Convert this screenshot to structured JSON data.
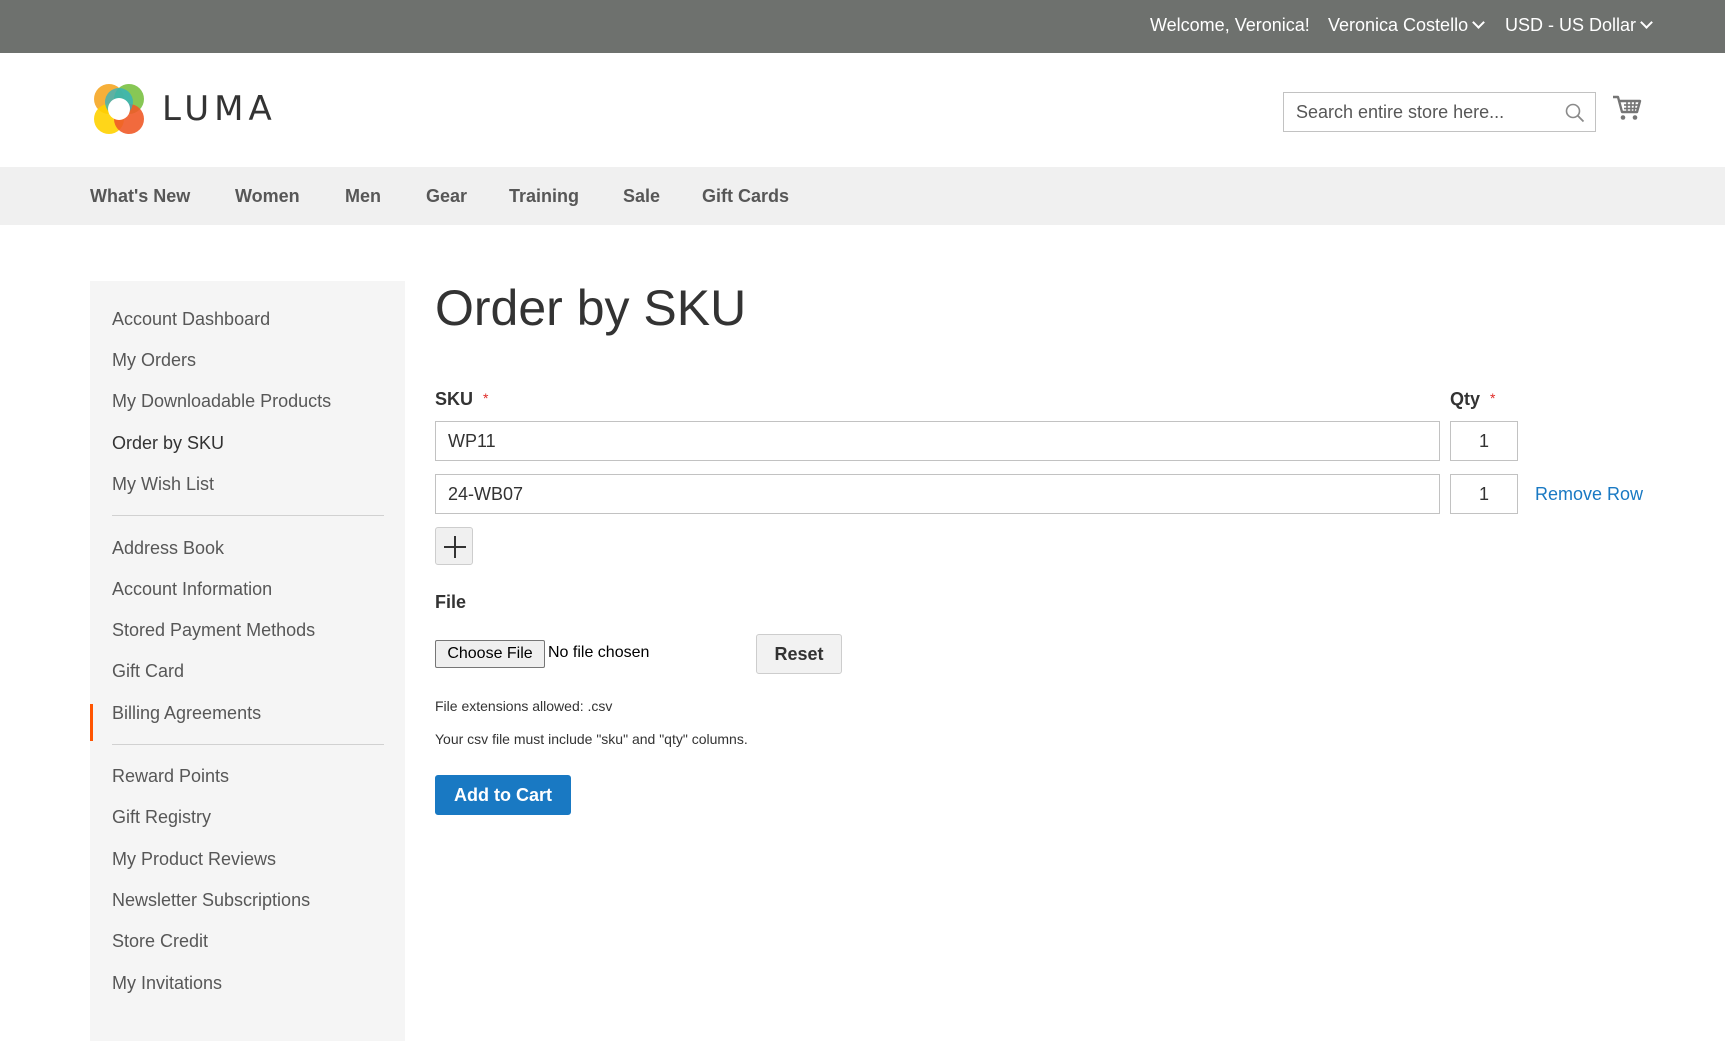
{
  "top_bar": {
    "welcome": "Welcome, Veronica!",
    "customer_name": "Veronica Costello",
    "currency": "USD - US Dollar"
  },
  "header": {
    "logo_text": "LUMA",
    "search_placeholder": "Search entire store here...",
    "cart_icon": "cart-icon"
  },
  "nav": {
    "items": [
      "What's New",
      "Women",
      "Men",
      "Gear",
      "Training",
      "Sale",
      "Gift Cards"
    ]
  },
  "sidebar": {
    "groups": [
      [
        "Account Dashboard",
        "My Orders",
        "My Downloadable Products",
        "Order by SKU",
        "My Wish List"
      ],
      [
        "Address Book",
        "Account Information",
        "Stored Payment Methods",
        "Gift Card",
        "Billing Agreements"
      ],
      [
        "Reward Points",
        "Gift Registry",
        "My Product Reviews",
        "Newsletter Subscriptions",
        "Store Credit",
        "My Invitations"
      ]
    ],
    "current": "Order by SKU"
  },
  "main": {
    "title": "Order by SKU",
    "sku_label": "SKU",
    "qty_label": "Qty",
    "required_mark": "*",
    "rows": [
      {
        "sku": "WP11",
        "qty": "1"
      },
      {
        "sku": "24-WB07",
        "qty": "1"
      }
    ],
    "remove_row": "Remove Row",
    "file_label": "File",
    "choose_file": "Choose File",
    "no_file": "No file chosen",
    "reset": "Reset",
    "extensions_note": "File extensions allowed: .csv",
    "csv_note": "Your csv file must include \"sku\" and \"qty\" columns.",
    "add_to_cart": "Add to Cart"
  },
  "colors": {
    "top_bar": "#6e716e",
    "accent_blue": "#1979c3",
    "active_marker": "#ff5501",
    "required": "#e02b27"
  }
}
